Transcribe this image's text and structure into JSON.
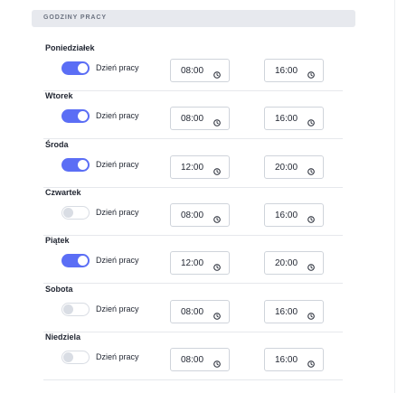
{
  "section_title": "GODZINY PRACY",
  "working_day_label": "Dzień pracy",
  "days": [
    {
      "name": "Poniedziałek",
      "working": true,
      "start": "08:00",
      "end": "16:00"
    },
    {
      "name": "Wtorek",
      "working": true,
      "start": "08:00",
      "end": "16:00"
    },
    {
      "name": "Środa",
      "working": true,
      "start": "12:00",
      "end": "20:00"
    },
    {
      "name": "Czwartek",
      "working": false,
      "start": "08:00",
      "end": "16:00"
    },
    {
      "name": "Piątek",
      "working": true,
      "start": "12:00",
      "end": "20:00"
    },
    {
      "name": "Sobota",
      "working": false,
      "start": "08:00",
      "end": "16:00"
    },
    {
      "name": "Niedziela",
      "working": false,
      "start": "08:00",
      "end": "16:00"
    }
  ],
  "colors": {
    "accent": "#5b6ef5",
    "header_bg": "#e7e9ee"
  },
  "icons": {
    "time_icon": "clock-icon"
  }
}
